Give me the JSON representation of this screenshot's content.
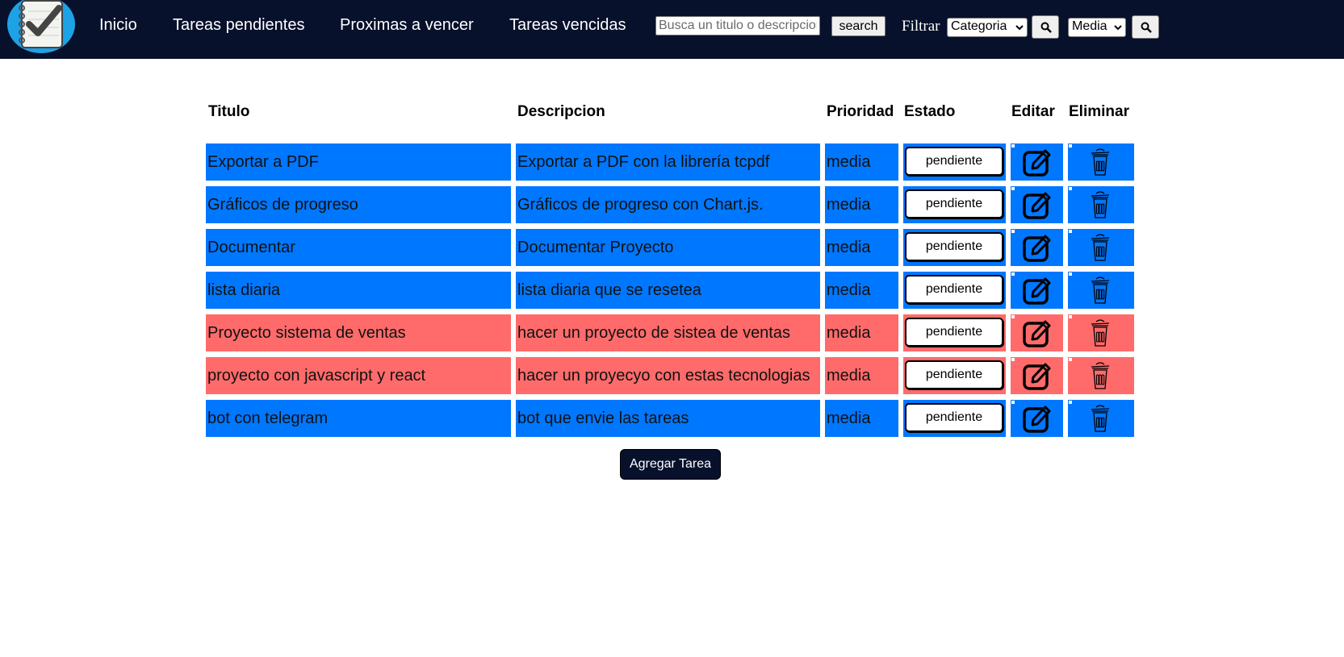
{
  "colors": {
    "navbar_bg": "#07112b",
    "row_blue": "#0077ff",
    "row_red": "#ff6b6b",
    "logo_bg": "#1ea2e6"
  },
  "nav": {
    "logo_icon": "checklist-notepad-icon",
    "links": [
      "Inicio",
      "Tareas pendientes",
      "Proximas a vencer",
      "Tareas vencidas"
    ],
    "search": {
      "placeholder": "Busca un titulo o descripcion",
      "value": "",
      "button_label": "search"
    },
    "filter_label": "Filtrar",
    "category_select": {
      "selected": "Categoria"
    },
    "priority_select": {
      "selected": "Media"
    },
    "filter_button_icon": "magnifier-icon"
  },
  "table": {
    "headers": [
      "Titulo",
      "Descripcion",
      "Prioridad",
      "Estado",
      "Editar",
      "Eliminar"
    ],
    "rows": [
      {
        "color": "blue",
        "titulo": "Exportar a PDF",
        "descripcion": "Exportar a PDF con la librería tcpdf",
        "prioridad": "media",
        "estado": "pendiente"
      },
      {
        "color": "blue",
        "titulo": "Gráficos de progreso",
        "descripcion": "Gráficos de progreso con Chart.js.",
        "prioridad": "media",
        "estado": "pendiente"
      },
      {
        "color": "blue",
        "titulo": "Documentar",
        "descripcion": "Documentar Proyecto",
        "prioridad": "media",
        "estado": "pendiente"
      },
      {
        "color": "blue",
        "titulo": "lista diaria",
        "descripcion": "lista diaria que se resetea",
        "prioridad": "media",
        "estado": "pendiente"
      },
      {
        "color": "red",
        "titulo": "Proyecto sistema de ventas",
        "descripcion": "hacer un proyecto de sistea de ventas",
        "prioridad": "media",
        "estado": "pendiente"
      },
      {
        "color": "red",
        "titulo": "proyecto con javascript y react",
        "descripcion": "hacer un proyecyo con estas tecnologias",
        "prioridad": "media",
        "estado": "pendiente"
      },
      {
        "color": "blue",
        "titulo": "bot con telegram",
        "descripcion": "bot que envie las tareas",
        "prioridad": "media",
        "estado": "pendiente"
      }
    ],
    "edit_icon": "edit-pencil-square-icon",
    "delete_icon": "trash-can-icon"
  },
  "add_button_label": "Agregar Tarea"
}
